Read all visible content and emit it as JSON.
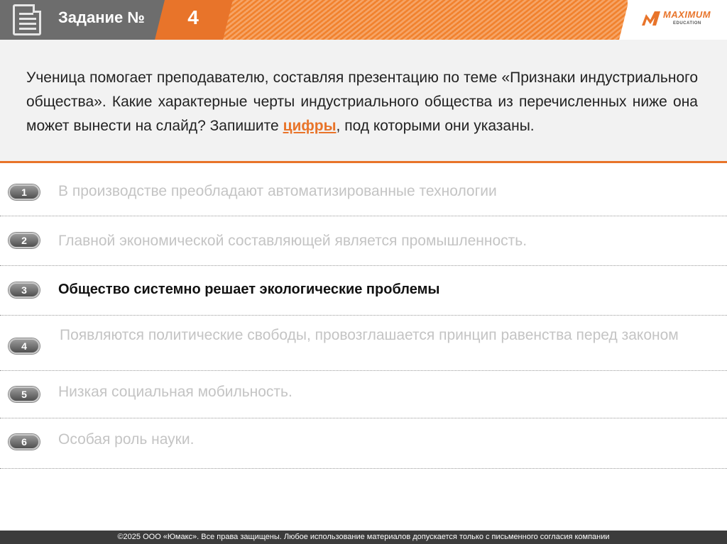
{
  "header": {
    "title": "Задание №",
    "number": "4",
    "logo_text": "MAXIMUM",
    "logo_subtext": "EDUCATION"
  },
  "question": {
    "text_before": "Ученица помогает преподавателю, составляя презентацию по теме «Признаки индустриального общества». Какие характерные черты индустриального общества из перечисленных ниже она может вынести на слайд? Запишите ",
    "highlight": "цифры",
    "text_after": ", под которыми они указаны."
  },
  "options": [
    {
      "number": "1",
      "text": "В производстве преобладают автоматизированные технологии"
    },
    {
      "number": "2",
      "text": "Главной экономической составляющей является промышленность."
    },
    {
      "number": "3",
      "text": "Общество системно решает экологические проблемы"
    },
    {
      "number": "4",
      "text": "Появляются политические свободы, провозглашается принцип равенства перед законом"
    },
    {
      "number": "5",
      "text": "Низкая социальная мобильность."
    },
    {
      "number": "6",
      "text": "Особая роль науки."
    }
  ],
  "footer": {
    "text": "©2025 ООО «Юмакс». Все права защищены. Любое использование материалов допускается только с  письменного согласия компании"
  },
  "colors": {
    "accent": "#e8742a",
    "header_gray": "#6d6d6d",
    "footer": "#3c3c3c"
  }
}
